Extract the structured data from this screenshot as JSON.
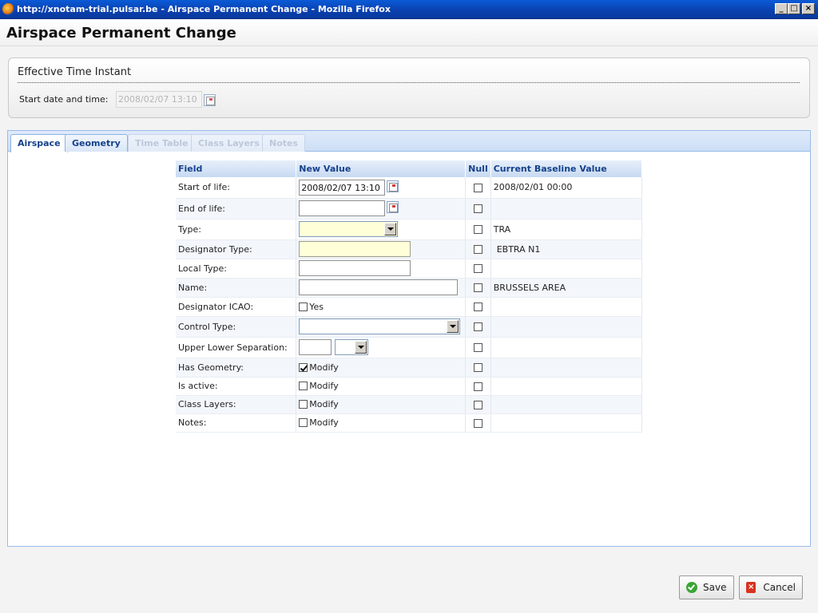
{
  "window": {
    "title": "http://xnotam-trial.pulsar.be - Airspace Permanent Change - Mozilla Firefox",
    "min": "_",
    "max": "□",
    "close": "×"
  },
  "page": {
    "heading": "Airspace Permanent Change"
  },
  "effective": {
    "legend": "Effective Time Instant",
    "start_label": "Start date and time:",
    "start_value": "2008/02/07 13:10"
  },
  "tabs": [
    {
      "label": "Airspace",
      "state": "active"
    },
    {
      "label": "Geometry",
      "state": "enabled"
    },
    {
      "label": "Time Table",
      "state": "disabled"
    },
    {
      "label": "Class Layers",
      "state": "disabled"
    },
    {
      "label": "Notes",
      "state": "disabled"
    }
  ],
  "grid": {
    "headers": {
      "field": "Field",
      "new_value": "New Value",
      "null": "Null",
      "baseline": "Current Baseline Value"
    },
    "rows": {
      "start_of_life": {
        "field": "Start of life:",
        "value": "2008/02/07 13:10",
        "baseline": "2008/02/01 00:00"
      },
      "end_of_life": {
        "field": "End of life:",
        "value": "",
        "baseline": ""
      },
      "type": {
        "field": "Type:",
        "value": "",
        "baseline": "TRA"
      },
      "designator_type": {
        "field": "Designator Type:",
        "value": "",
        "baseline": "EBTRA N1"
      },
      "local_type": {
        "field": "Local Type:",
        "value": "",
        "baseline": ""
      },
      "name": {
        "field": "Name:",
        "value": "",
        "baseline": "BRUSSELS AREA"
      },
      "designator_icao": {
        "field": "Designator ICAO:",
        "check_label": "Yes",
        "checked": false
      },
      "control_type": {
        "field": "Control Type:",
        "value": ""
      },
      "upper_lower": {
        "field": "Upper Lower Separation:",
        "value": ""
      },
      "has_geometry": {
        "field": "Has Geometry:",
        "check_label": "Modify",
        "checked": true
      },
      "is_active": {
        "field": "Is active:",
        "check_label": "Modify",
        "checked": false
      },
      "class_layers": {
        "field": "Class Layers:",
        "check_label": "Modify",
        "checked": false
      },
      "notes": {
        "field": "Notes:",
        "check_label": "Modify",
        "checked": false
      }
    }
  },
  "footer": {
    "save": "Save",
    "cancel": "Cancel"
  },
  "icons": [
    "firefox-icon",
    "calendar-icon",
    "dropdown-arrow-icon",
    "save-check-icon",
    "cancel-x-icon"
  ],
  "colors": {
    "title_bar": "#0a3fae",
    "tab_text": "#15428b",
    "required_field": "#ffffd8",
    "panel_border": "#99bbe8"
  }
}
